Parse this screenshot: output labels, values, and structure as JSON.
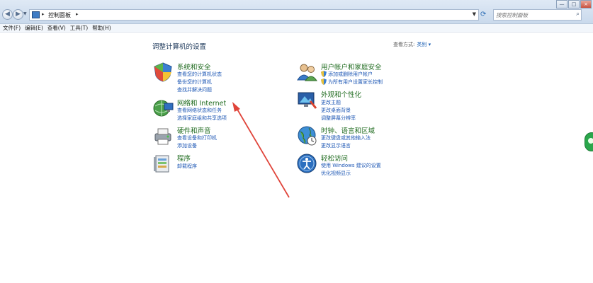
{
  "address": {
    "breadcrumb": "控制面板",
    "search_placeholder": "搜索控制面板"
  },
  "menu": [
    "文件(F)",
    "编辑(E)",
    "查看(V)",
    "工具(T)",
    "帮助(H)"
  ],
  "headline": "调整计算机的设置",
  "view_by": {
    "label": "查看方式:",
    "value": "类别 ▾"
  },
  "categories": [
    {
      "title": "系统和安全",
      "links": [
        "查看您的计算机状态",
        "备份您的计算机",
        "查找并解决问题"
      ]
    },
    {
      "title": "网络和 Internet",
      "links": [
        "查看网络状态和任务",
        "选择家庭组和共享选项"
      ]
    },
    {
      "title": "硬件和声音",
      "links": [
        "查看设备和打印机",
        "添加设备"
      ]
    },
    {
      "title": "程序",
      "links": [
        "卸载程序"
      ]
    },
    {
      "title": "用户帐户和家庭安全",
      "links": [
        "添加或删除用户帐户",
        "为所有用户设置家长控制"
      ]
    },
    {
      "title": "外观和个性化",
      "links": [
        "更改主题",
        "更改桌面背景",
        "调整屏幕分辨率"
      ]
    },
    {
      "title": "时钟、语言和区域",
      "links": [
        "更改键盘或其他输入法",
        "更改显示语言"
      ]
    },
    {
      "title": "轻松访问",
      "links": [
        "使用 Windows 建议的设置",
        "优化视频显示"
      ]
    }
  ],
  "window_buttons": {
    "minimize": "—",
    "maximize": "□",
    "close": "×"
  },
  "colors": {
    "category_title": "#1f6b1f",
    "link": "#1f58b5",
    "arrow": "#e0443a"
  }
}
